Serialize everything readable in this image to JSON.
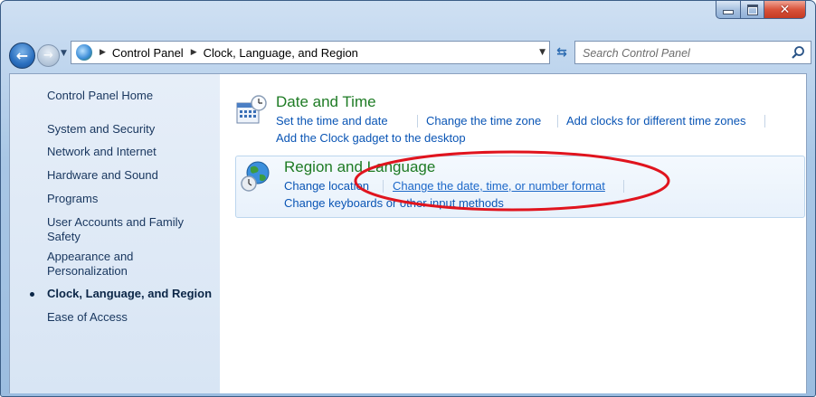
{
  "window": {
    "minimize_icon": "minimize-icon",
    "maximize_icon": "maximize-icon",
    "close_icon": "close-icon"
  },
  "nav": {
    "back_icon": "back-arrow-icon",
    "forward_icon": "forward-arrow-icon",
    "breadcrumbs": [
      "Control Panel",
      "Clock, Language, and Region"
    ],
    "search_placeholder": "Search Control Panel"
  },
  "sidebar": {
    "home": "Control Panel Home",
    "items": [
      {
        "label": "System and Security"
      },
      {
        "label": "Network and Internet"
      },
      {
        "label": "Hardware and Sound"
      },
      {
        "label": "Programs"
      },
      {
        "label": "User Accounts and Family Safety"
      },
      {
        "label": "Appearance and Personalization"
      },
      {
        "label": "Clock, Language, and Region",
        "active": true
      },
      {
        "label": "Ease of Access"
      }
    ]
  },
  "sections": [
    {
      "title": "Date and Time",
      "icon": "calendar-clock-icon",
      "links": [
        "Set the time and date",
        "Change the time zone",
        "Add clocks for different time zones",
        "Add the Clock gadget to the desktop"
      ]
    },
    {
      "title": "Region and Language",
      "icon": "globe-clock-icon",
      "links": [
        "Change location",
        "Change the date, time, or number format",
        "Change keyboards or other input methods"
      ]
    }
  ],
  "annotation": {
    "color": "#e0141e"
  }
}
